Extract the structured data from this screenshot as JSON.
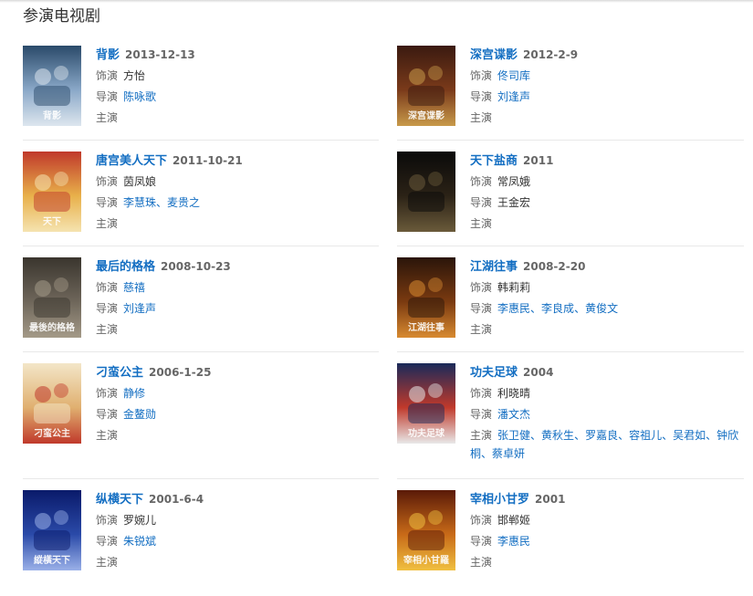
{
  "section_title": "参演电视剧",
  "labels": {
    "role": "饰演",
    "director": "导演",
    "cast": "主演"
  },
  "dramas": [
    {
      "title": "背影",
      "date": "2013-12-13",
      "role": "方怡",
      "role_link": false,
      "directors": [
        "陈咏歌"
      ],
      "director_link": true,
      "cast": [],
      "poster_text": "背影",
      "poster_colors": [
        "#2a4a6a",
        "#8aa8c8",
        "#dde6ee"
      ]
    },
    {
      "title": "深宫谍影",
      "date": "2012-2-9",
      "role": "佟司库",
      "role_link": true,
      "directors": [
        "刘逢声"
      ],
      "director_link": true,
      "cast": [],
      "poster_text": "深宫谍影",
      "poster_colors": [
        "#3a1a10",
        "#7a3a1a",
        "#c89a4a"
      ]
    },
    {
      "title": "唐宫美人天下",
      "date": "2011-10-21",
      "role": "茵凤娘",
      "role_link": false,
      "directors": [
        "李慧珠",
        "麦贵之"
      ],
      "director_link": true,
      "cast": [],
      "poster_text": "天下",
      "poster_colors": [
        "#c0392b",
        "#e8b04a",
        "#f5e3b0"
      ]
    },
    {
      "title": "天下盐商",
      "date": "2011",
      "role": "常凤娥",
      "role_link": false,
      "directors": [
        "王金宏"
      ],
      "director_link": false,
      "cast": [],
      "poster_text": "",
      "poster_colors": [
        "#0a0a0a",
        "#2b2216",
        "#6a5a3a"
      ]
    },
    {
      "title": "最后的格格",
      "date": "2008-10-23",
      "role": "慈禧",
      "role_link": true,
      "directors": [
        "刘逢声"
      ],
      "director_link": true,
      "cast": [],
      "poster_text": "最後的格格",
      "poster_colors": [
        "#3a352e",
        "#6e665a",
        "#a49a88"
      ]
    },
    {
      "title": "江湖往事",
      "date": "2008-2-20",
      "role": "韩莉莉",
      "role_link": false,
      "directors": [
        "李惠民",
        "李良成",
        "黄俊文"
      ],
      "director_link": true,
      "cast": [],
      "poster_text": "江湖往事",
      "poster_colors": [
        "#2a150a",
        "#7a3a10",
        "#d88a30"
      ]
    },
    {
      "title": "刁蛮公主",
      "date": "2006-1-25",
      "role": "静修",
      "role_link": true,
      "directors": [
        "金鳌勋"
      ],
      "director_link": true,
      "cast": [],
      "poster_text": "刁蛮公主",
      "poster_colors": [
        "#f3e6c8",
        "#e0b070",
        "#c0392b"
      ]
    },
    {
      "title": "功夫足球",
      "date": "2004",
      "role": "利晓晴",
      "role_link": false,
      "directors": [
        "潘文杰"
      ],
      "director_link": true,
      "cast": [
        "张卫健",
        "黄秋生",
        "罗嘉良",
        "容祖儿",
        "吴君如",
        "钟欣桐",
        "蔡卓妍"
      ],
      "poster_text": "功夫足球",
      "poster_colors": [
        "#1a2a5a",
        "#c0392b",
        "#e8e8e8"
      ]
    },
    {
      "title": "纵横天下",
      "date": "2001-6-4",
      "role": "罗婉儿",
      "role_link": false,
      "directors": [
        "朱锐斌"
      ],
      "director_link": true,
      "cast": [],
      "poster_text": "縱橫天下",
      "poster_colors": [
        "#0a1a6a",
        "#2a4aa8",
        "#9ab0e8"
      ]
    },
    {
      "title": "宰相小甘罗",
      "date": "2001",
      "role": "邯郸姬",
      "role_link": false,
      "directors": [
        "李惠民"
      ],
      "director_link": true,
      "cast": [],
      "poster_text": "宰相小甘羅",
      "poster_colors": [
        "#5a1a08",
        "#c86a18",
        "#f0c040"
      ]
    }
  ]
}
